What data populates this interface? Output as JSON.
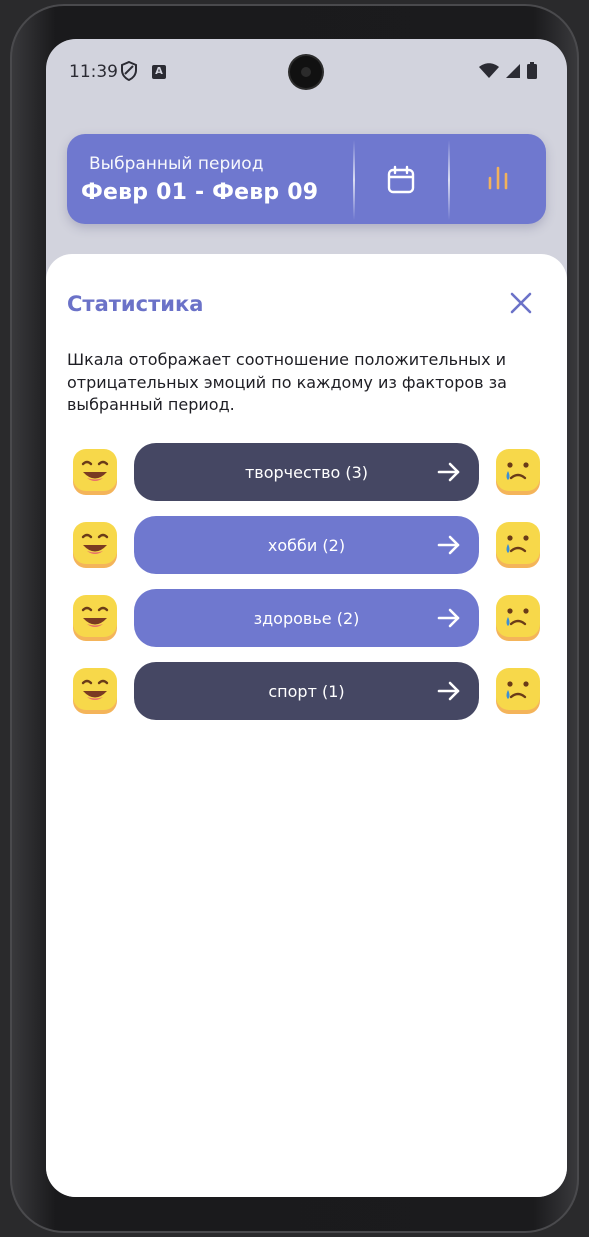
{
  "status": {
    "time": "11:39",
    "a_badge": "A"
  },
  "period": {
    "label": "Выбранный период",
    "range": "Февр 01 - Февр 09"
  },
  "sheet": {
    "title": "Статистика",
    "description": "Шкала отображает соотношение положительных и отрицательных эмоций по каждому из факторов за выбранный период.",
    "factors": [
      {
        "label": "творчество (3)",
        "color": "#454763"
      },
      {
        "label": "хобби (2)",
        "color": "#6f78cf"
      },
      {
        "label": "здоровье (2)",
        "color": "#6f78cf"
      },
      {
        "label": "спорт (1)",
        "color": "#454763"
      }
    ]
  },
  "colors": {
    "accent": "#6f78cf",
    "dark_pill": "#454763",
    "title": "#6b72c8",
    "chart_icon": "#f2b25c",
    "emoji_yellow": "#f7d84a",
    "emoji_base": "#f4b45a"
  },
  "icons": {
    "calendar": "calendar-icon",
    "statistics": "bar-chart-icon",
    "close": "close-icon",
    "arrow": "arrow-right-icon",
    "happy": "happy-emoji-icon",
    "sad": "sad-emoji-icon"
  }
}
